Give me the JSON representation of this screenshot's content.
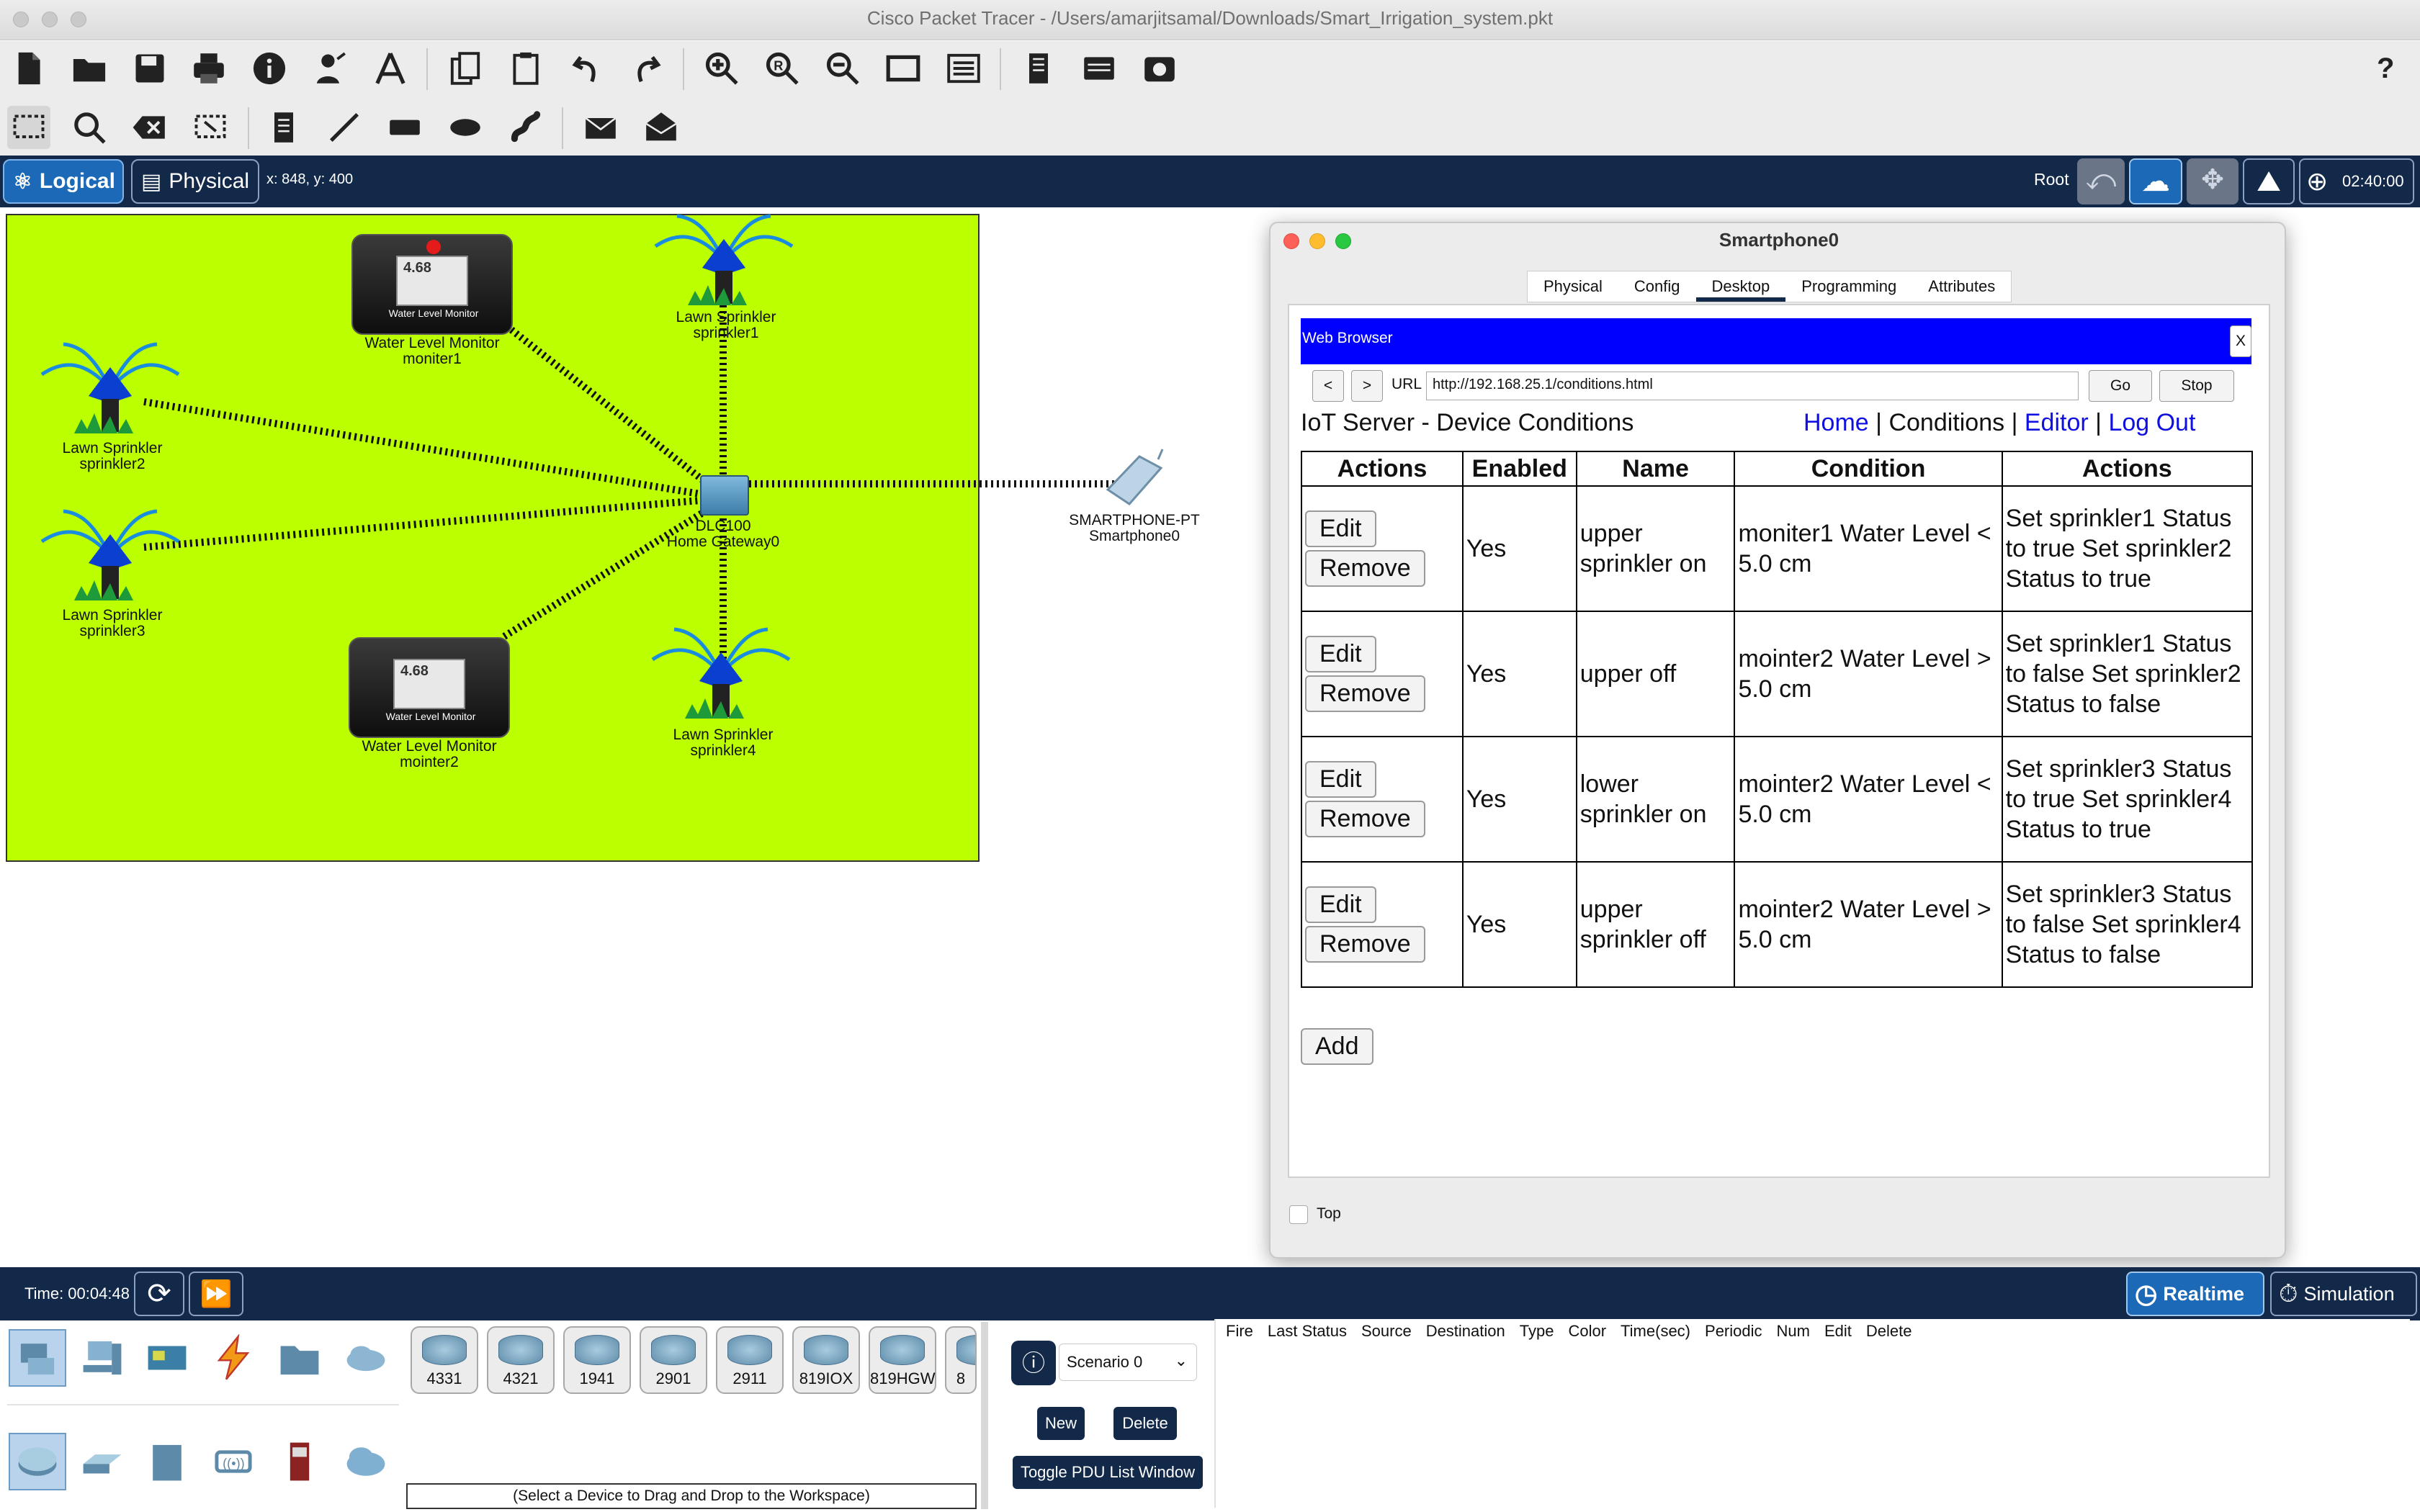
{
  "window": {
    "title": "Cisco Packet Tracer - /Users/amarjitsamal/Downloads/Smart_Irrigation_system.pkt",
    "help": "?"
  },
  "toolbar": {
    "main_icons": [
      "new-file-icon",
      "open-folder-icon",
      "save-icon",
      "print-icon",
      "info-icon",
      "activity-wizard-icon",
      "custom-drawing-icon",
      "copy-icon",
      "paste-icon",
      "undo-icon",
      "redo-icon",
      "zoom-in-icon",
      "zoom-reset-icon",
      "zoom-out-icon",
      "drawing-palette-icon",
      "custom-device-icon",
      "physical-view-icon",
      "network-info-icon",
      "image-icon"
    ],
    "tool_icons": [
      "select-icon",
      "inspect-icon",
      "delete-icon",
      "resize-icon",
      "note-icon",
      "line-icon",
      "rectangle-icon",
      "ellipse-icon",
      "freeform-icon",
      "simple-pdu-icon",
      "complex-pdu-icon"
    ]
  },
  "navbar": {
    "logical": "Logical",
    "physical": "Physical",
    "coords": "x: 848, y: 400",
    "root": "Root",
    "clock": "02:40:00"
  },
  "workspace": {
    "devices": {
      "monitor1": {
        "value": "4.68",
        "screen_label": "Water Level Monitor",
        "label1": "Water Level Monitor",
        "label2": "moniter1"
      },
      "monitor2": {
        "value": "4.68",
        "screen_label": "Water Level Monitor",
        "label1": "Water Level Monitor",
        "label2": "mointer2"
      },
      "sprinkler1": {
        "label1": "Lawn Sprinkler",
        "label2": "sprinkler1"
      },
      "sprinkler2": {
        "label1": "Lawn Sprinkler",
        "label2": "sprinkler2"
      },
      "sprinkler3": {
        "label1": "Lawn Sprinkler",
        "label2": "sprinkler3"
      },
      "sprinkler4": {
        "label1": "Lawn Sprinkler",
        "label2": "sprinkler4"
      },
      "gateway": {
        "label1": "DLC100",
        "label2": "Home Gateway0"
      },
      "smartphone": {
        "label1": "SMARTPHONE-PT",
        "label2": "Smartphone0"
      }
    }
  },
  "popup": {
    "title": "Smartphone0",
    "tabs": [
      "Physical",
      "Config",
      "Desktop",
      "Programming",
      "Attributes"
    ],
    "active_tab": "Desktop",
    "browser": {
      "title": "Web Browser",
      "close": "X",
      "back": "<",
      "forward": ">",
      "url_label": "URL",
      "url": "http://192.168.25.1/conditions.html",
      "go": "Go",
      "stop": "Stop"
    },
    "page": {
      "heading": "IoT Server - Device Conditions",
      "nav": {
        "home": "Home",
        "conditions": "Conditions",
        "editor": "Editor",
        "logout": "Log Out",
        "sep": "|"
      },
      "columns": [
        "Actions",
        "Enabled",
        "Name",
        "Condition",
        "Actions"
      ],
      "rows": [
        {
          "enabled": "Yes",
          "name": "upper sprinkler on",
          "condition": "moniter1 Water Level < 5.0 cm",
          "actions": "Set sprinkler1 Status to true Set sprinkler2 Status to true"
        },
        {
          "enabled": "Yes",
          "name": "upper off",
          "condition": "mointer2 Water Level > 5.0 cm",
          "actions": "Set sprinkler1 Status to false Set sprinkler2 Status to false"
        },
        {
          "enabled": "Yes",
          "name": "lower sprinkler on",
          "condition": "mointer2 Water Level < 5.0 cm",
          "actions": "Set sprinkler3 Status to true Set sprinkler4 Status to true"
        },
        {
          "enabled": "Yes",
          "name": "upper sprinkler off",
          "condition": "mointer2 Water Level > 5.0 cm",
          "actions": "Set sprinkler3 Status to false Set sprinkler4 Status to false"
        }
      ],
      "edit_label": "Edit",
      "remove_label": "Remove",
      "add_label": "Add"
    },
    "top_checkbox": "Top"
  },
  "bottom": {
    "time": "Time: 00:04:48",
    "realtime": "Realtime",
    "simulation": "Simulation",
    "models": [
      "4331",
      "4321",
      "1941",
      "2901",
      "2911",
      "819IOX",
      "819HGW",
      "8"
    ],
    "hint": "(Select a Device to Drag and Drop to the Workspace)",
    "scenario": "Scenario 0",
    "new": "New",
    "delete": "Delete",
    "toggle_pdu": "Toggle PDU List Window",
    "pdu_columns": [
      "Fire",
      "Last Status",
      "Source",
      "Destination",
      "Type",
      "Color",
      "Time(sec)",
      "Periodic",
      "Num",
      "Edit",
      "Delete"
    ]
  },
  "colors": {
    "navbar": "#12294a",
    "workspace_area": "#bbff00",
    "browser_bar": "#0000ff",
    "link": "#1010e0"
  }
}
